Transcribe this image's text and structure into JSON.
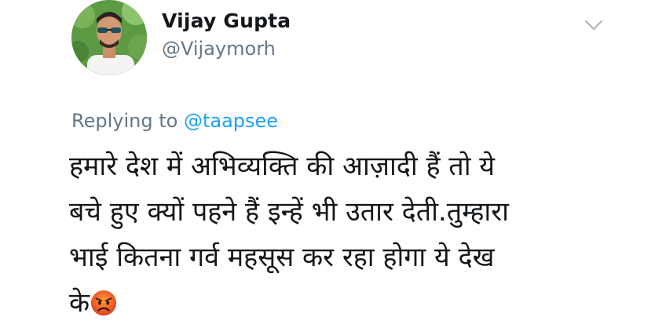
{
  "author": {
    "display_name": "Vijay Gupta",
    "handle": "@Vijaymorh"
  },
  "reply": {
    "prefix": "Replying to",
    "mention": "@taapsee"
  },
  "tweet": {
    "lines": [
      "हमारे देश में अभिव्यक्ति की आज़ादी हैं तो ये",
      "बचे हुए क्यों पहने हैं इन्हें भी उतार देती.तुम्हारा",
      "भाई कितना गर्व महसूस कर रहा होगा ये देख",
      "के"
    ],
    "emoji": "pouting-face-emoji"
  },
  "icons": {
    "menu": "chevron-down-icon"
  },
  "colors": {
    "text": "#14171a",
    "secondary": "#657786",
    "link": "#1da1f2"
  }
}
